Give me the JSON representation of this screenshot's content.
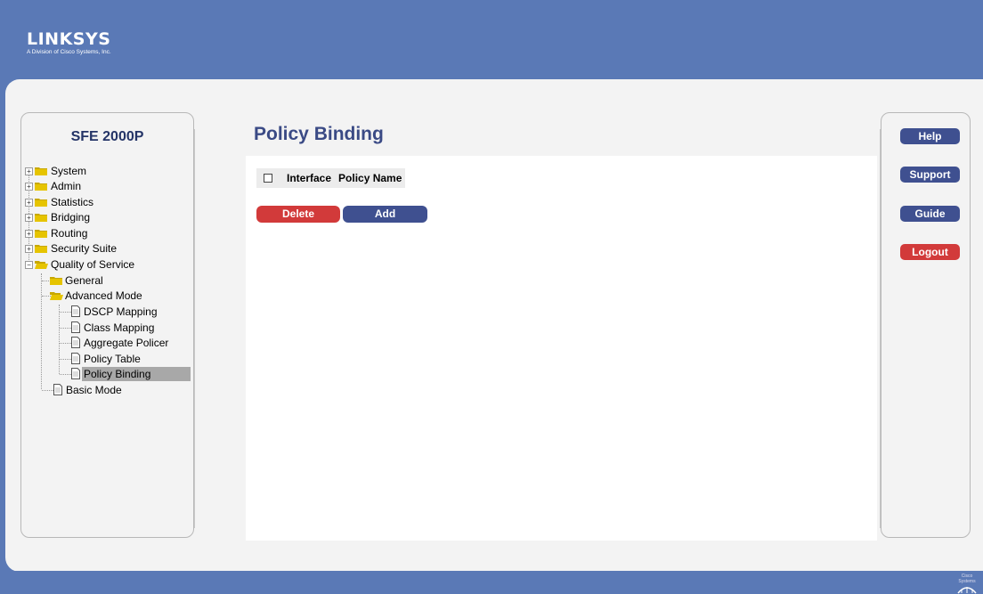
{
  "brand": {
    "name": "LINKSYS",
    "tagline": "A Division of Cisco Systems, Inc."
  },
  "device": {
    "model": "SFE 2000P"
  },
  "nav": {
    "items": [
      {
        "label": "System"
      },
      {
        "label": "Admin"
      },
      {
        "label": "Statistics"
      },
      {
        "label": "Bridging"
      },
      {
        "label": "Routing"
      },
      {
        "label": "Security Suite"
      },
      {
        "label": "Quality of Service"
      },
      {
        "label": "General"
      },
      {
        "label": "Advanced Mode"
      },
      {
        "label": "DSCP Mapping"
      },
      {
        "label": "Class Mapping"
      },
      {
        "label": "Aggregate Policer"
      },
      {
        "label": "Policy Table"
      },
      {
        "label": "Policy Binding"
      },
      {
        "label": "Basic Mode"
      }
    ],
    "selected": "Policy Binding"
  },
  "page": {
    "title": "Policy Binding"
  },
  "table": {
    "columns": [
      "Interface",
      "Policy Name"
    ]
  },
  "actions": {
    "delete_label": "Delete",
    "add_label": "Add"
  },
  "side_buttons": {
    "help": "Help",
    "support": "Support",
    "guide": "Guide",
    "logout": "Logout"
  },
  "footer": {
    "cisco_text": "Cisco Systems"
  },
  "colors": {
    "header": "#5a79b6",
    "accent_blue": "#3f5090",
    "accent_red": "#d23a3a",
    "title": "#3a4a85"
  }
}
